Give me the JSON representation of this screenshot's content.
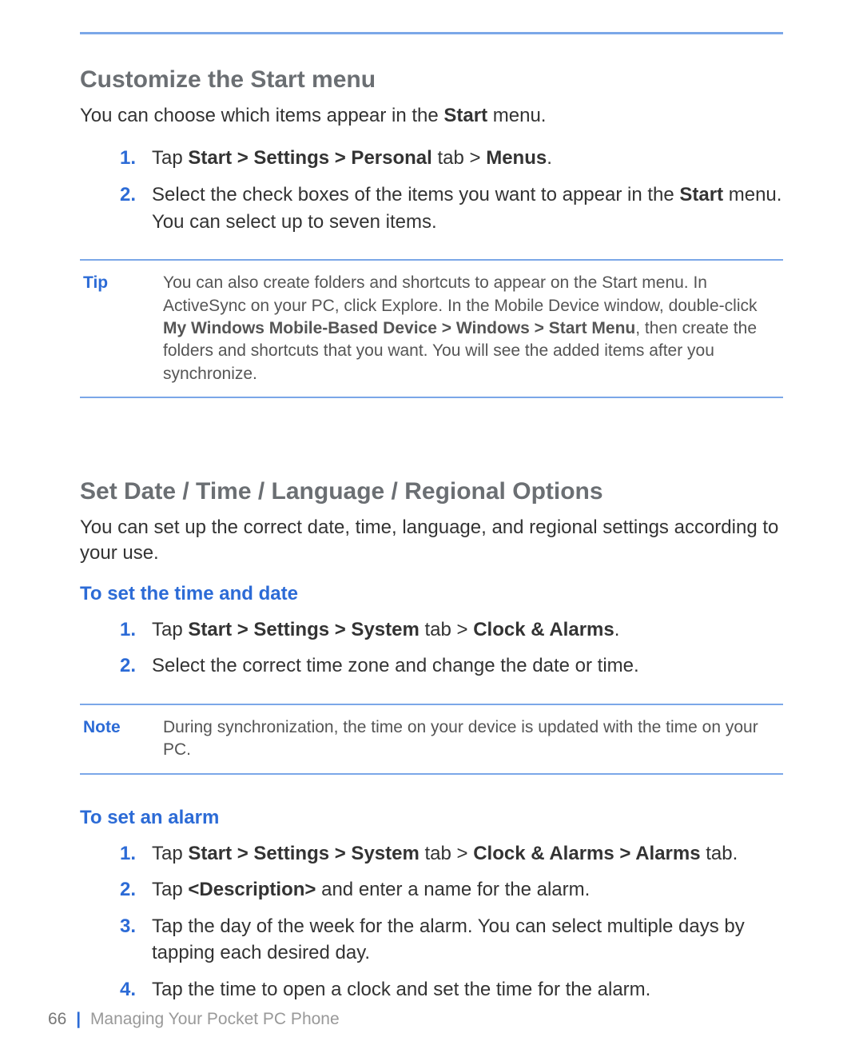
{
  "strings": {
    "s1_title": "Customize the Start menu",
    "s1_intro_a": "You can choose which items appear in the ",
    "s1_intro_b": "Start",
    "s1_intro_c": " menu.",
    "s1_step1_a": "Tap ",
    "s1_step1_b": "Start > Settings > Personal",
    "s1_step1_c": " tab > ",
    "s1_step1_d": "Menus",
    "s1_step1_e": ".",
    "s1_step2_a": "Select the check boxes of the items you want to appear in the ",
    "s1_step2_b": "Start",
    "s1_step2_c": " menu. You can select up to seven items.",
    "tip_label": "Tip",
    "tip_a": "You can also create folders and shortcuts to appear on the Start menu. In ActiveSync on your PC, click Explore. In the Mobile Device window, double-click ",
    "tip_b": "My Windows Mobile-Based Device > Windows > Start Menu",
    "tip_c": ", then create the folders and shortcuts that you want. You will see the added items after you synchronize.",
    "s2_title": "Set Date / Time / Language / Regional Options",
    "s2_intro": "You can set up the correct date, time, language, and regional settings according to your use.",
    "sub_time": "To set the time and date",
    "t_step1_a": "Tap ",
    "t_step1_b": "Start > Settings > System",
    "t_step1_c": " tab > ",
    "t_step1_d": "Clock & Alarms",
    "t_step1_e": ".",
    "t_step2": "Select the correct time zone and change the date or time.",
    "note_label": "Note",
    "note_body": "During synchronization, the time on your device is updated with the time on your PC.",
    "sub_alarm": "To set an alarm",
    "a_step1_a": "Tap ",
    "a_step1_b": "Start > Settings > System",
    "a_step1_c": " tab > ",
    "a_step1_d": "Clock & Alarms > Alarms",
    "a_step1_e": " tab.",
    "a_step2_a": "Tap ",
    "a_step2_b": "<Description>",
    "a_step2_c": " and enter a name for the alarm.",
    "a_step3": "Tap the day of the week for the alarm. You can select multiple days by tapping each desired day.",
    "a_step4": "Tap the time to open a clock and set the time for the alarm.",
    "num1": "1.",
    "num2": "2.",
    "num3": "3.",
    "num4": "4.",
    "page_num": "66",
    "footer_title": "Managing Your Pocket PC Phone"
  }
}
